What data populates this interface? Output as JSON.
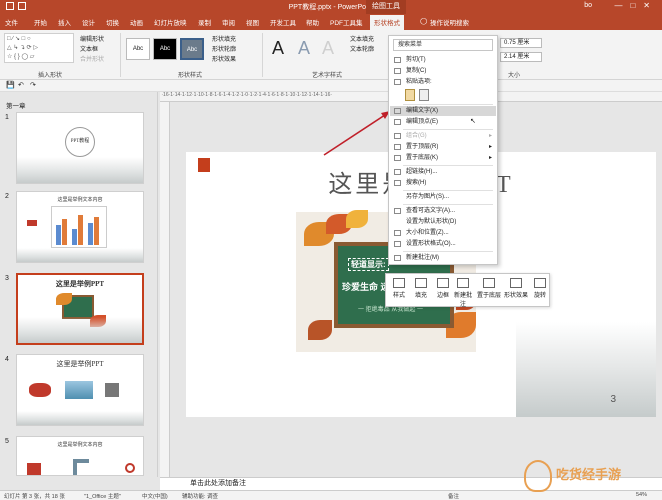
{
  "titlebar": {
    "title": "PPT教程.pptx  -  PowerPoint",
    "context_tab": "绘图工具",
    "user": "bo"
  },
  "tabs": [
    "文件",
    "开始",
    "插入",
    "设计",
    "切换",
    "动画",
    "幻灯片放映",
    "录制",
    "审阅",
    "视图",
    "开发工具",
    "帮助",
    "PDF工具集",
    "形状格式",
    "操作说明搜索"
  ],
  "ribbon": {
    "insert_shape": {
      "label": "插入形状",
      "edit_shape": "编辑形状",
      "text_box": "文本框",
      "merge_shape": "合并形状"
    },
    "shape_style": {
      "label": "形状样式",
      "sample": "Abc",
      "fill": "形状填充",
      "outline": "形状轮廓",
      "effect": "形状效果"
    },
    "wordart": {
      "label": "艺术字样式",
      "sample": "A",
      "text_fill": "文本填充",
      "text_outline": "文本轮廓"
    },
    "size": {
      "label": "大小",
      "height": "0.75 厘米",
      "width": "2.14 厘米"
    }
  },
  "thumbs": {
    "section": "第一章",
    "slides": [
      {
        "num": "1",
        "title": "PPT教程"
      },
      {
        "num": "2",
        "title": "这里是举例文本内容"
      },
      {
        "num": "3",
        "title": "这里是举例PPT"
      },
      {
        "num": "4",
        "title": "这里是举例PPT"
      },
      {
        "num": "5",
        "title": "这里是举例文本内容"
      }
    ]
  },
  "slide": {
    "title": "这里是举例PPT",
    "board_line1": "轻道显示:",
    "board_line2": "珍爱生命 远离毒品",
    "board_line3": "一 拒绝毒品 从我做起 一",
    "page_number": "3"
  },
  "context_menu": {
    "search": "搜索菜单",
    "items": [
      {
        "label": "剪切(T)",
        "disabled": false,
        "submenu": false
      },
      {
        "label": "复制(C)",
        "disabled": false,
        "submenu": false
      },
      {
        "label": "粘贴选项:",
        "disabled": false,
        "submenu": false
      },
      {
        "label": "编辑文字(X)",
        "disabled": false,
        "submenu": false,
        "highlighted": true
      },
      {
        "label": "编辑顶点(E)",
        "disabled": false,
        "submenu": false
      },
      {
        "label": "组合(G)",
        "disabled": true,
        "submenu": true
      },
      {
        "label": "置于顶层(R)",
        "disabled": false,
        "submenu": true
      },
      {
        "label": "置于底层(K)",
        "disabled": false,
        "submenu": true
      },
      {
        "label": "超链接(H)...",
        "disabled": false,
        "submenu": false
      },
      {
        "label": "搜索(H)",
        "disabled": false,
        "submenu": false
      },
      {
        "label": "另存为图片(S)...",
        "disabled": false,
        "submenu": false
      },
      {
        "label": "查看可选文字(A)...",
        "disabled": false,
        "submenu": false
      },
      {
        "label": "设置为默认形状(D)",
        "disabled": false,
        "submenu": false
      },
      {
        "label": "大小和位置(Z)...",
        "disabled": false,
        "submenu": false
      },
      {
        "label": "设置形状格式(O)...",
        "disabled": false,
        "submenu": false
      },
      {
        "label": "新建批注(M)",
        "disabled": false,
        "submenu": false
      }
    ]
  },
  "mini_toolbar": [
    "样式",
    "填充",
    "边框",
    "新建批注",
    "置于底层",
    "形状效果",
    "旋转"
  ],
  "notes": "单击此处添加备注",
  "status": {
    "slide_info": "幻灯片 第 3 张，共 18 张",
    "theme": "\"1_Office 主题\"",
    "language": "中文(中国)",
    "accessibility": "辅助功能: 调查",
    "notes_btn": "备注",
    "zoom": "54%"
  },
  "watermark": "吃货经手游",
  "colors": {
    "accent": "#b7472a",
    "selection": "#c43e1c",
    "board": "#2f6e4d"
  }
}
